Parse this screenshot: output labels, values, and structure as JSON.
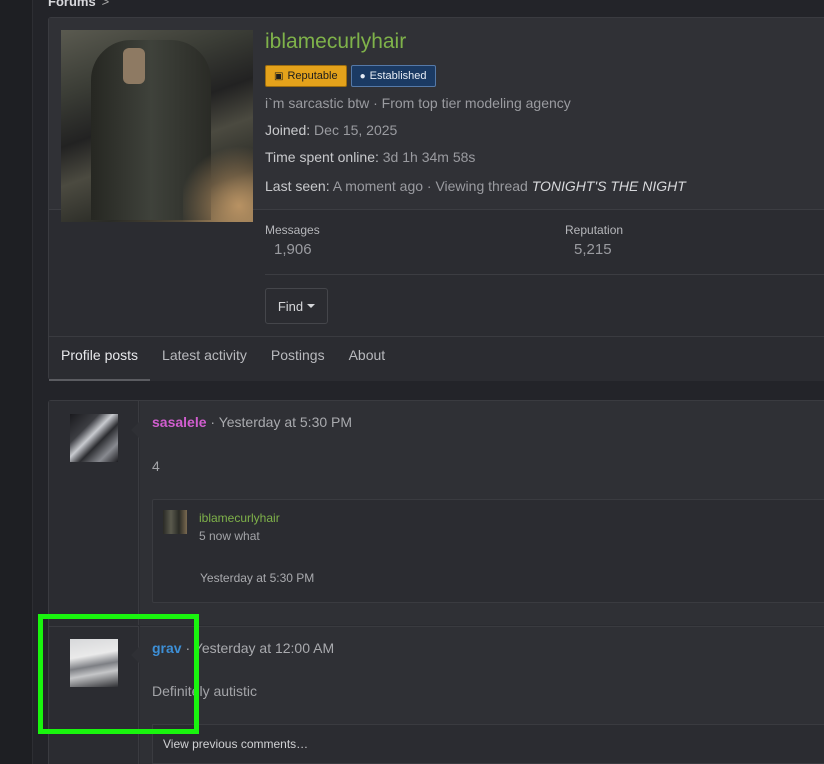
{
  "breadcrumb": {
    "label": "Forums",
    "chevron": ">"
  },
  "profile": {
    "username": "iblamecurlyhair",
    "badges": [
      {
        "label": "Reputable",
        "icon": "handshake-icon",
        "color": "#e4a21b"
      },
      {
        "label": "Established",
        "icon": "user-icon",
        "color": "#1b3a63"
      }
    ],
    "blurb": "i`m sarcastic btw · From top tier modeling agency",
    "joined_label": "Joined:",
    "joined_value": "Dec 15, 2025",
    "online_label": "Time spent online:",
    "online_value": "3d 1h 34m 58s",
    "last_seen_label": "Last seen:",
    "last_seen_value": "A moment ago · Viewing thread",
    "last_seen_thread": "TONIGHT'S THE NIGHT",
    "stats": [
      {
        "label": "Messages",
        "value": "1,906"
      },
      {
        "label": "Reputation",
        "value": "5,215"
      }
    ],
    "find_label": "Find"
  },
  "tabs": [
    {
      "label": "Profile posts",
      "active": true
    },
    {
      "label": "Latest activity",
      "active": false
    },
    {
      "label": "Postings",
      "active": false
    },
    {
      "label": "About",
      "active": false
    }
  ],
  "posts": [
    {
      "author": "sasalele",
      "time": "· Yesterday at 5:30 PM",
      "body": "4",
      "comment": {
        "author": "iblamecurlyhair",
        "text": "5 now what",
        "time": "Yesterday at 5:30 PM"
      }
    },
    {
      "author": "grav",
      "time": "· Yesterday at 12:00 AM",
      "body": "Definitely autistic",
      "view_previous": "View previous comments…"
    }
  ],
  "colors": {
    "username_green": "#7fb24a",
    "author_pink": "#d15ecf",
    "author_blue": "#3d8fd6",
    "highlight": "#19f50e"
  }
}
